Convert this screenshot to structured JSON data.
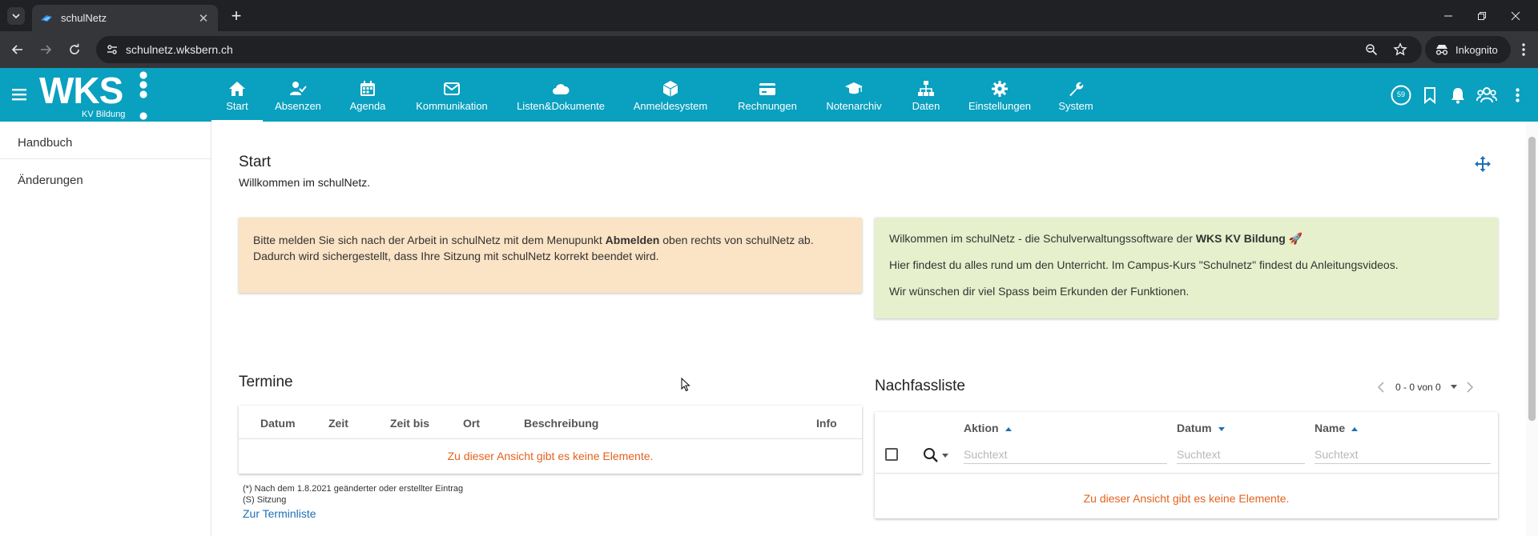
{
  "browser": {
    "tab_title": "schulNetz",
    "url": "schulnetz.wksbern.ch",
    "profile_label": "Inkognito"
  },
  "app": {
    "logo_text": "WKS",
    "logo_sub": "KV Bildung",
    "badge_count": "59",
    "nav": [
      {
        "label": "Start",
        "icon": "home-icon",
        "active": true
      },
      {
        "label": "Absenzen",
        "icon": "user-check-icon"
      },
      {
        "label": "Agenda",
        "icon": "calendar-icon"
      },
      {
        "label": "Kommunikation",
        "icon": "envelope-icon"
      },
      {
        "label": "Listen&Dokumente",
        "icon": "cloud-icon"
      },
      {
        "label": "Anmeldesystem",
        "icon": "cube-icon"
      },
      {
        "label": "Rechnungen",
        "icon": "credit-card-icon"
      },
      {
        "label": "Notenarchiv",
        "icon": "graduation-cap-icon"
      },
      {
        "label": "Daten",
        "icon": "sitemap-icon"
      },
      {
        "label": "Einstellungen",
        "icon": "gear-icon"
      },
      {
        "label": "System",
        "icon": "wrench-icon"
      }
    ]
  },
  "sidebar": {
    "items": [
      {
        "label": "Handbuch"
      },
      {
        "label": "Änderungen"
      }
    ]
  },
  "page": {
    "title": "Start",
    "subtitle": "Willkommen im schulNetz."
  },
  "alert_logout": {
    "line1_pre": "Bitte melden Sie sich nach der Arbeit in schulNetz mit dem Menupunkt ",
    "line1_bold": "Abmelden",
    "line1_post": " oben rechts von schulNetz ab.",
    "line2": "Dadurch wird sichergestellt, dass Ihre Sitzung mit schulNetz korrekt beendet wird."
  },
  "alert_welcome": {
    "line1_pre": "Wilkommen im schulNetz - die Schulverwaltungssoftware der ",
    "line1_bold": "WKS KV Bildung",
    "line1_emoji": "🚀",
    "line2": "Hier findest du alles rund um den Unterricht. Im Campus-Kurs \"Schulnetz\" findest du Anleitungsvideos.",
    "line3": "Wir wünschen dir viel Spass beim Erkunden der Funktionen."
  },
  "termine": {
    "title": "Termine",
    "columns": [
      "Datum",
      "Zeit",
      "Zeit bis",
      "Ort",
      "Beschreibung",
      "Info"
    ],
    "empty": "Zu dieser Ansicht gibt es keine Elemente.",
    "legend1": "(*) Nach dem 1.8.2021 geänderter oder erstellter Eintrag",
    "legend2": "(S) Sitzung",
    "link": "Zur Terminliste"
  },
  "nachfass": {
    "title": "Nachfassliste",
    "pager_text": "0 - 0 von 0",
    "columns": [
      "Aktion",
      "Datum",
      "Name"
    ],
    "filter_placeholder": "Suchtext",
    "empty": "Zu dieser Ansicht gibt es keine Elemente."
  },
  "colors": {
    "brand": "#0aa0bf",
    "alert_orange": "#fbe3c5",
    "alert_green": "#e6f0cc",
    "empty_text": "#e2631f",
    "link": "#1f6fb5"
  }
}
